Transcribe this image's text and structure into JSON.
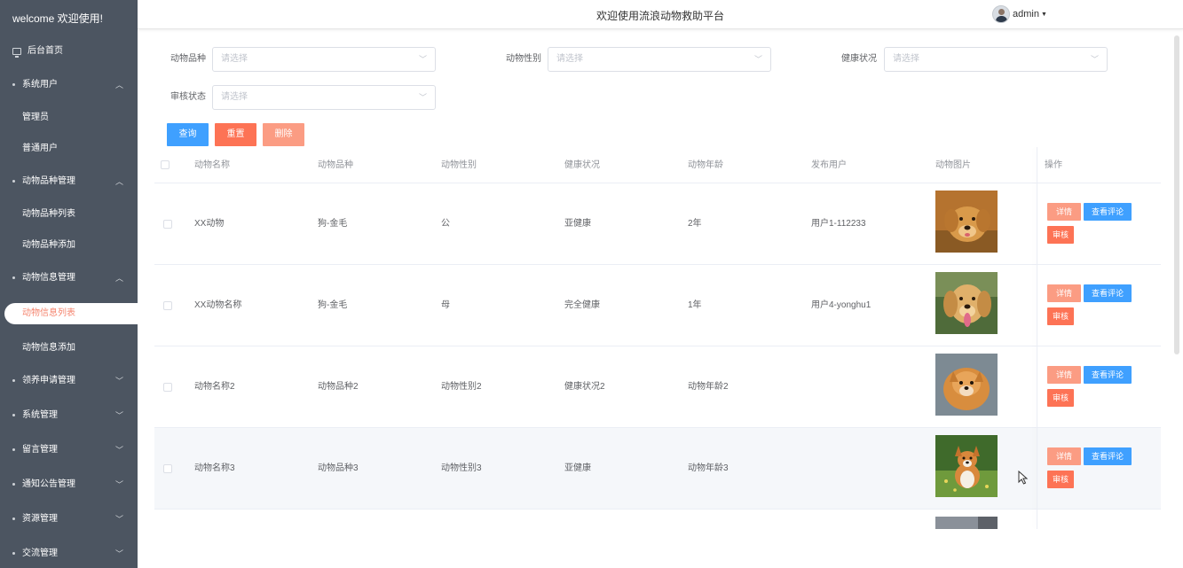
{
  "sidebar": {
    "welcome": "welcome 欢迎使用!",
    "home": "后台首页",
    "items": [
      {
        "label": "系统用户",
        "type": "group",
        "expanded": true
      },
      {
        "label": "管理员",
        "type": "sub"
      },
      {
        "label": "普通用户",
        "type": "sub"
      },
      {
        "label": "动物品种管理",
        "type": "group",
        "expanded": true
      },
      {
        "label": "动物品种列表",
        "type": "sub"
      },
      {
        "label": "动物品种添加",
        "type": "sub"
      },
      {
        "label": "动物信息管理",
        "type": "group",
        "expanded": true
      },
      {
        "label": "动物信息列表",
        "type": "sub",
        "active": true
      },
      {
        "label": "动物信息添加",
        "type": "sub"
      },
      {
        "label": "领养申请管理",
        "type": "group",
        "expanded": false
      },
      {
        "label": "系统管理",
        "type": "group",
        "expanded": false
      },
      {
        "label": "留言管理",
        "type": "group",
        "expanded": false
      },
      {
        "label": "通知公告管理",
        "type": "group",
        "expanded": false
      },
      {
        "label": "资源管理",
        "type": "group",
        "expanded": false
      },
      {
        "label": "交流管理",
        "type": "group",
        "expanded": false
      }
    ]
  },
  "header": {
    "title": "欢迎使用流浪动物救助平台",
    "user": "admin"
  },
  "filters": {
    "breed_label": "动物品种",
    "gender_label": "动物性别",
    "health_label": "健康状况",
    "audit_label": "审核状态",
    "placeholder": "请选择"
  },
  "buttons": {
    "search": "查询",
    "reset": "重置",
    "delete": "删除"
  },
  "table": {
    "headers": [
      "动物名称",
      "动物品种",
      "动物性别",
      "健康状况",
      "动物年龄",
      "发布用户",
      "动物图片",
      "操作"
    ],
    "rows": [
      {
        "name": "XX动物",
        "breed": "狗-金毛",
        "gender": "公",
        "health": "亚健康",
        "age": "2年",
        "user": "用户1-112233",
        "image": "golden-retriever"
      },
      {
        "name": "XX动物名称",
        "breed": "狗-金毛",
        "gender": "母",
        "health": "完全健康",
        "age": "1年",
        "user": "用户4-yonghu1",
        "image": "golden-retriever-tongue"
      },
      {
        "name": "动物名称2",
        "breed": "动物品种2",
        "gender": "动物性别2",
        "health": "健康状况2",
        "age": "动物年龄2",
        "user": "",
        "image": "fluffy-puppy"
      },
      {
        "name": "动物名称3",
        "breed": "动物品种3",
        "gender": "动物性别3",
        "health": "亚健康",
        "age": "动物年龄3",
        "user": "",
        "image": "corgi-on-grass"
      }
    ],
    "actions": {
      "detail": "详情",
      "comments": "查看评论",
      "audit": "审核"
    }
  },
  "colors": {
    "sidebar_bg": "#4c5561",
    "active_text": "#f5856f",
    "primary": "#3fa0ff",
    "danger": "#fd7355",
    "warning": "#fb9c83"
  }
}
